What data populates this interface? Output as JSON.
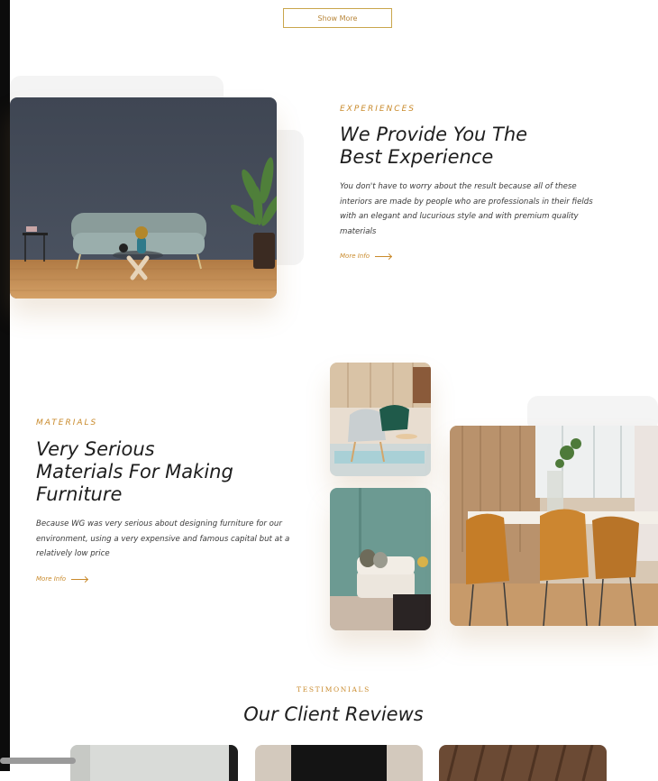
{
  "top": {
    "show_more_label": "Show More"
  },
  "experience": {
    "eyebrow": "EXPERIENCES",
    "title_line1": "We Provide You The",
    "title_line2": "Best Experience",
    "description_line1": "You don't have to worry about the result because all of these",
    "description_line2": "interiors are made by people who are professionals in their fields",
    "description_line3": "with an elegant and lucurious style and with premium quality",
    "description_line4": "materials",
    "more_info_label": "More Info"
  },
  "materials": {
    "eyebrow": "MATERIALS",
    "title_line1": "Very Serious",
    "title_line2": "Materials For Making",
    "title_line3": "Furniture",
    "description_line1": "Because WG was very serious about designing furniture for our",
    "description_line2": "environment, using a very expensive and famous capital but at a",
    "description_line3": "relatively low price",
    "more_info_label": "More Info"
  },
  "testimonials": {
    "eyebrow": "TESTIMONIALS",
    "title": "Our Client Reviews"
  },
  "colors": {
    "accent": "#c98a2b",
    "wall_dark": "#434a58",
    "floor_wood": "#c08a4e",
    "wall_teal": "#6c9a92"
  }
}
